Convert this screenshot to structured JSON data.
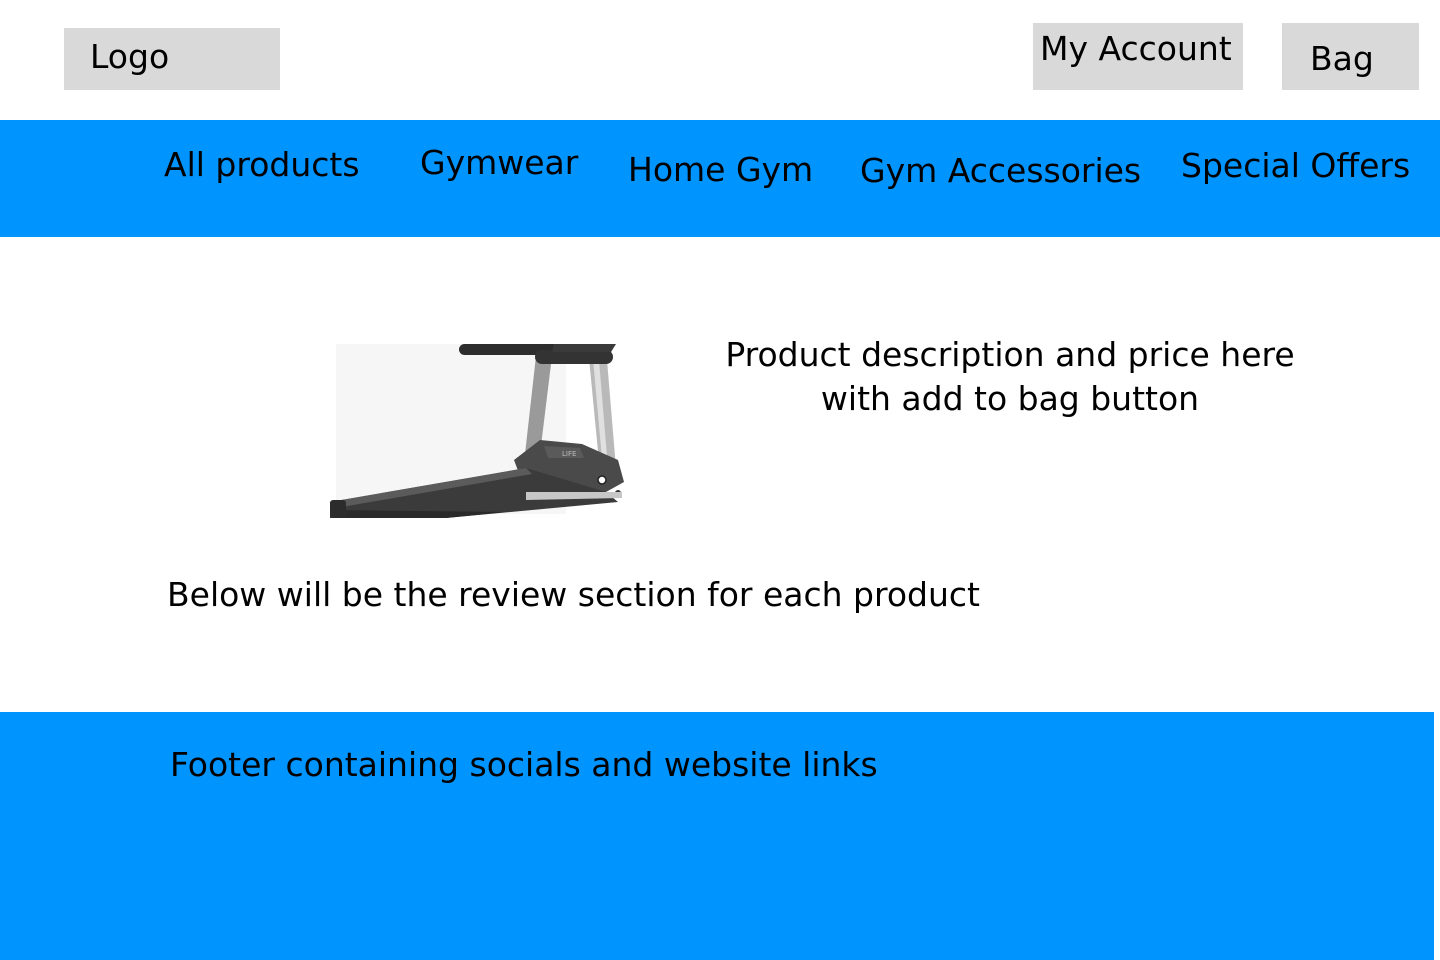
{
  "header": {
    "logo_label": "Logo",
    "account_label": "My Account",
    "bag_label": "Bag"
  },
  "nav": {
    "items": [
      {
        "label": "All products"
      },
      {
        "label": "Gymwear"
      },
      {
        "label": "Home Gym"
      },
      {
        "label": "Gym Accessories"
      },
      {
        "label": "Special Offers"
      }
    ]
  },
  "product": {
    "image_icon": "treadmill-image",
    "description_line1": "Product description and price here",
    "description_line2": "with add to bag button"
  },
  "reviews": {
    "placeholder_text": "Below will be the review section for each product"
  },
  "footer": {
    "placeholder_text": "Footer containing socials and website links"
  },
  "colors": {
    "nav_background": "#0094ff",
    "footer_background": "#0094ff",
    "placeholder_box": "#d9d9d9"
  }
}
